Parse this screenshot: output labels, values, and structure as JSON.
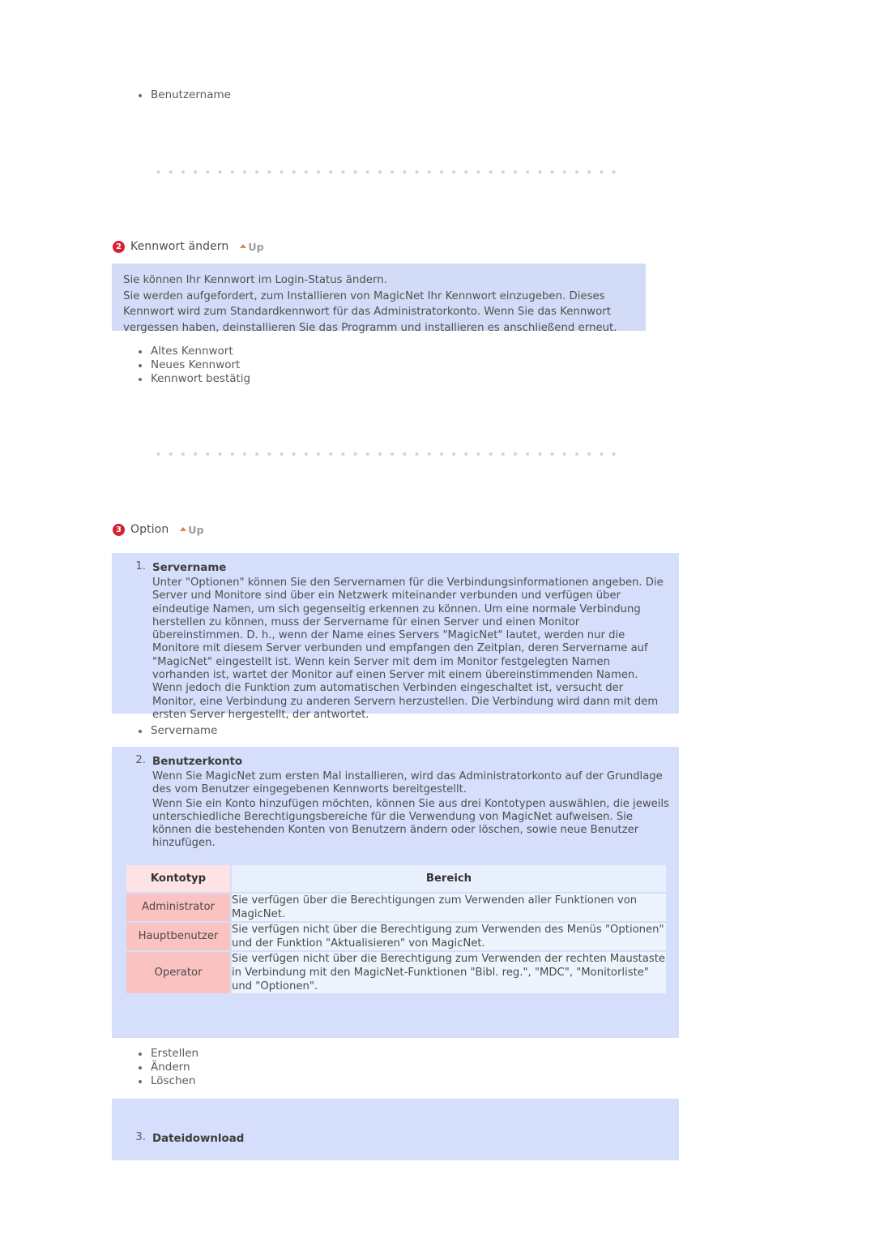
{
  "top_list": {
    "items": [
      "Benutzername"
    ]
  },
  "dividers": {
    "style": "dotted",
    "color": "#d2d2d2"
  },
  "sections": [
    {
      "number": "2",
      "title": "Kennwort ändern",
      "up_label": "Up",
      "info_lines": [
        "Sie können Ihr Kennwort im Login-Status ändern.",
        "Sie werden aufgefordert, zum Installieren von MagicNet Ihr Kennwort einzugeben. Dieses Kennwort wird zum Standardkennwort für das Administratorkonto. Wenn Sie das Kennwort vergessen haben, deinstallieren Sie das Programm und installieren es anschließend erneut."
      ],
      "bullets": [
        "Altes Kennwort",
        "Neues Kennwort",
        "Kennwort bestätig"
      ]
    },
    {
      "number": "3",
      "title": "Option",
      "up_label": "Up"
    }
  ],
  "option": {
    "servername": {
      "marker": "1.",
      "title": "Servername",
      "text": "Unter \"Optionen\" können Sie den Servernamen für die Verbindungsinformationen angeben. Die Server und Monitore sind über ein Netzwerk miteinander verbunden und verfügen über eindeutige Namen, um sich gegenseitig erkennen zu können. Um eine normale Verbindung herstellen zu können, muss der Servername für einen Server und einen Monitor übereinstimmen. D. h., wenn der Name eines Servers \"MagicNet\" lautet, werden nur die Monitore mit diesem Server verbunden und empfangen den Zeitplan, deren Servername auf \"MagicNet\" eingestellt ist. Wenn kein Server mit dem im Monitor festgelegten Namen vorhanden ist, wartet der Monitor auf einen Server mit einem übereinstimmenden Namen. Wenn jedoch die Funktion zum automatischen Verbinden eingeschaltet ist, versucht der Monitor, eine Verbindung zu anderen Servern herzustellen. Die Verbindung wird dann mit dem ersten Server hergestellt, der antwortet.",
      "bullets": [
        "Servername"
      ]
    },
    "benutzerkonto": {
      "marker": "2.",
      "title": "Benutzerkonto",
      "paragraphs": [
        "Wenn Sie MagicNet zum ersten Mal installieren, wird das Administratorkonto auf der Grundlage des vom Benutzer eingegebenen Kennworts bereitgestellt.",
        "Wenn Sie ein Konto hinzufügen möchten, können Sie aus drei Kontotypen auswählen, die jeweils unterschiedliche Berechtigungsbereiche für die Verwendung von MagicNet aufweisen. Sie können die bestehenden Konten von Benutzern ändern oder löschen, sowie neue Benutzer hinzufügen."
      ],
      "table": {
        "headers": [
          "Kontotyp",
          "Bereich"
        ],
        "rows": [
          {
            "type": "Administrator",
            "scope": "Sie verfügen über die Berechtigungen zum Verwenden aller Funktionen von MagicNet."
          },
          {
            "type": "Hauptbenutzer",
            "scope": "Sie verfügen nicht über die Berechtigung zum Verwenden des Menüs \"Optionen\" und der Funktion \"Aktualisieren\" von MagicNet."
          },
          {
            "type": "Operator",
            "scope": "Sie verfügen nicht über die Berechtigung zum Verwenden der rechten Maustaste in Verbindung mit den MagicNet-Funktionen \"Bibl. reg.\", \"MDC\", \"Monitorliste\" und \"Optionen\"."
          }
        ]
      },
      "bullets": [
        "Erstellen",
        "Ändern",
        "Löschen"
      ]
    },
    "dateidownload": {
      "marker": "3.",
      "title": "Dateidownload"
    }
  },
  "colors": {
    "badge": "#d81f33",
    "info_panel": "#d2dcf7",
    "panel": "#d5defa",
    "table_header_type": "#fde3e3",
    "table_header_scope": "#e9f0fd",
    "table_type_cell": "#fac2c0",
    "table_scope_cell": "#eef4fe",
    "up_arrow": "#e8833a",
    "divider_dot": "#d2d2d2"
  }
}
